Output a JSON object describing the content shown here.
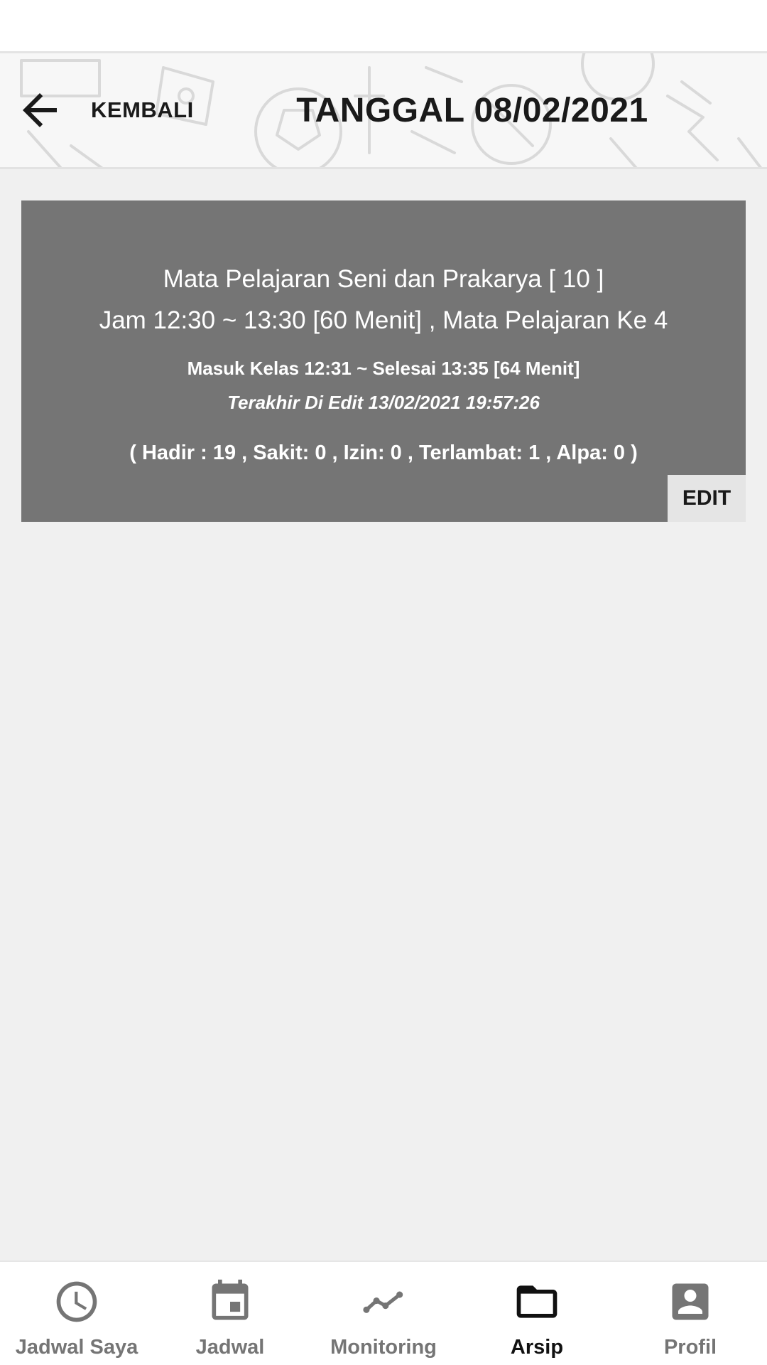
{
  "header": {
    "back_label": "KEMBALI",
    "title": "TANGGAL 08/02/2021"
  },
  "card": {
    "subject": "Mata Pelajaran Seni dan Prakarya [ 10 ]",
    "time": "Jam 12:30 ~ 13:30 [60 Menit] , Mata Pelajaran Ke 4",
    "checkin": "Masuk Kelas 12:31 ~ Selesai 13:35 [64 Menit]",
    "last_edited": "Terakhir Di Edit 13/02/2021 19:57:26",
    "attendance": "( Hadir : 19 , Sakit: 0 , Izin: 0 , Terlambat: 1 , Alpa: 0 )",
    "edit_label": "EDIT"
  },
  "bottom_nav": {
    "items": [
      {
        "label": "Jadwal Saya",
        "icon": "clock-icon",
        "active": false
      },
      {
        "label": "Jadwal",
        "icon": "calendar-icon",
        "active": false
      },
      {
        "label": "Monitoring",
        "icon": "trending-line-icon",
        "active": false
      },
      {
        "label": "Arsip",
        "icon": "folder-icon",
        "active": true
      },
      {
        "label": "Profil",
        "icon": "account-box-icon",
        "active": false
      }
    ]
  },
  "colors": {
    "card_background": "#757575",
    "edit_button_background": "#e5e5e5",
    "nav_inactive": "#757575",
    "nav_active": "#111111",
    "page_background": "#f0f0f0"
  }
}
